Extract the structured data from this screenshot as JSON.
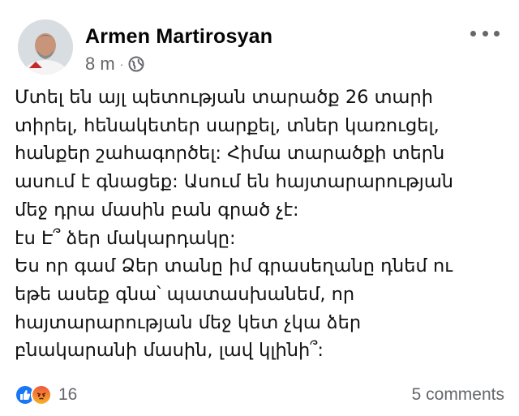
{
  "post": {
    "author_name": "Armen Martirosyan",
    "timestamp": "8 m",
    "separator": "·",
    "privacy_icon": "globe-icon",
    "more_icon": "more-options-icon",
    "body_lines": [
      "Մտել են այլ պետության տարածք 26 տարի",
      "տիրել, հենակետեր սարքել, տներ կառուցել,",
      "հանքեր շահագործել: Հիմա տարածքի տերն",
      "ասում է գնացեք: Ասում են հայտարարության",
      "մեջ դրա մասին բան գրած չէ:",
      "էս Է՞ ձեր մակարդակը:",
      "Ես որ գամ Ձեր տանը իմ գրասեղանը դնեմ ու",
      "եթե  ասեք գնա՝ պատասխանեմ, որ",
      "հայտարարության մեջ կետ չկա ձեր",
      "բնակարանի մասին, լավ կլինի՞:"
    ],
    "reactions": {
      "icons": [
        "like-icon",
        "angry-icon"
      ],
      "count": "16"
    },
    "comments_label": "5 comments"
  },
  "colors": {
    "like": "#1877f2",
    "secondary_text": "#65676b",
    "primary_text": "#050505"
  }
}
